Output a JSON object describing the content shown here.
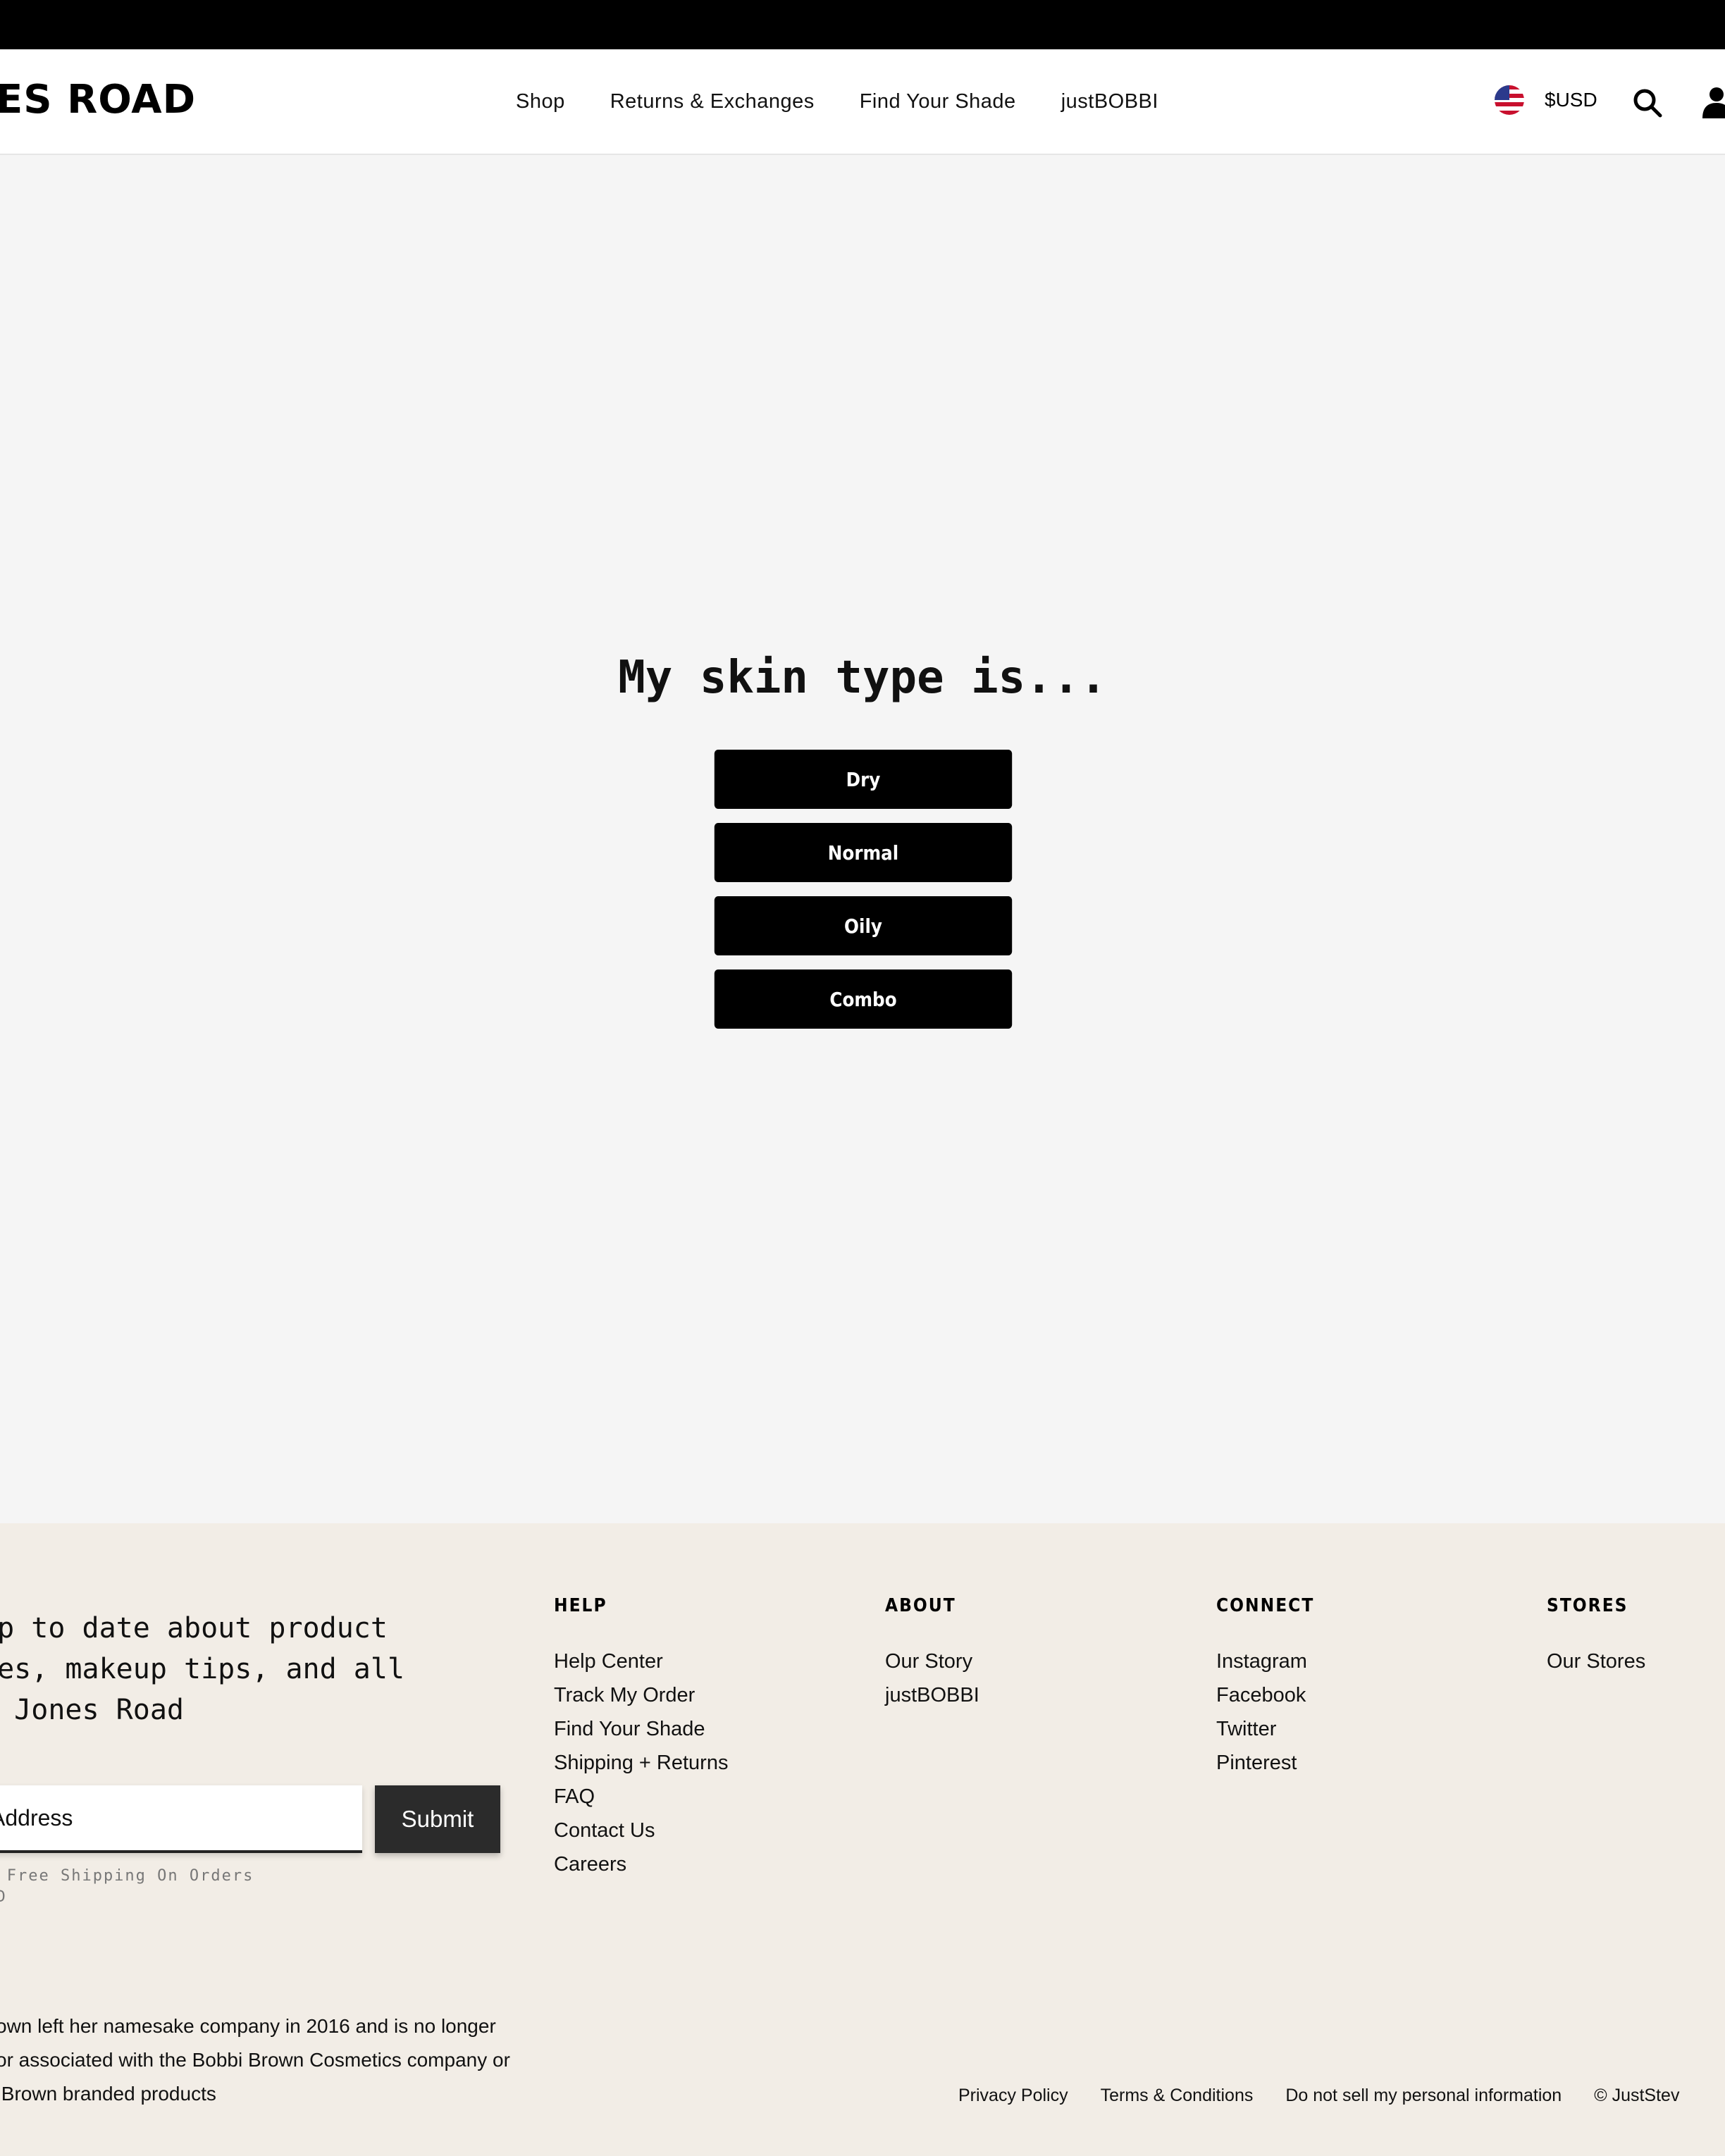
{
  "header": {
    "logo_text": "ES ROAD",
    "nav": [
      "Shop",
      "Returns & Exchanges",
      "Find Your Shade",
      "justBOBBI"
    ],
    "currency": "$USD",
    "icons": {
      "flag": "us-flag-icon",
      "search": "search-icon",
      "account": "user-icon"
    }
  },
  "quiz": {
    "title": "My skin type is...",
    "options": [
      "Dry",
      "Normal",
      "Oily",
      "Combo"
    ]
  },
  "footer": {
    "newsletter": {
      "lines": [
        "up to date about product",
        "nes, makeup tips, and all",
        "s Jones Road"
      ],
      "email_placeholder": "Address",
      "submit_label": "Submit",
      "shipping_note": [
        "or Free Shipping On Orders",
        "USD"
      ]
    },
    "columns": [
      {
        "heading": "HELP",
        "links": [
          "Help Center",
          "Track My Order",
          "Find Your Shade",
          "Shipping + Returns",
          "FAQ",
          "Contact Us",
          "Careers"
        ]
      },
      {
        "heading": "ABOUT",
        "links": [
          "Our Story",
          "justBOBBI"
        ]
      },
      {
        "heading": "CONNECT",
        "links": [
          "Instagram",
          "Facebook",
          "Twitter",
          "Pinterest"
        ]
      },
      {
        "heading": "STORES",
        "links": [
          "Our Stores"
        ]
      }
    ],
    "disclaimer": [
      "own left her namesake company in 2016 and is no longer",
      "or associated with the Bobbi Brown Cosmetics company or",
      " Brown branded products"
    ],
    "legal": [
      "Privacy Policy",
      "Terms & Conditions",
      "Do not sell my personal information"
    ],
    "copyright": "© JustStev"
  },
  "colors": {
    "page_bg": "#f5f5f5",
    "footer_bg": "#f2ede6",
    "button_bg": "#000000",
    "submit_bg": "#2b2b2b"
  }
}
